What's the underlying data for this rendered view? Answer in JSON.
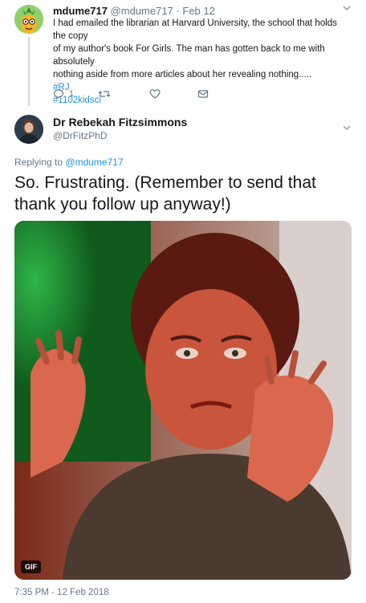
{
  "parent_tweet": {
    "display_name": "mdume717",
    "handle": "@mdume717",
    "separator": "·",
    "date": "Feb 12",
    "text_lines": [
      "I had emailed the librarian at Harvard University, the school that holds the copy",
      "of my author's book For Girls. The man has gotten back to me with absolutely",
      "nothing aside from more articles about her revealing nothing....."
    ],
    "hashtags": [
      "#RJ",
      "#1102kidsci"
    ],
    "reply_count": "1",
    "avatar_icon": "pineapple-avatar-icon"
  },
  "main_tweet": {
    "display_name": "Dr Rebekah Fitzsimmons",
    "handle": "@DrFitzPhD",
    "replying_to_prefix": "Replying to",
    "replying_to_handle": "@mdume717",
    "text": "So. Frustrating. (Remember to send that thank you follow up anyway!)",
    "media_badge": "GIF",
    "timestamp": "7:35 PM - 12 Feb 2018"
  },
  "colors": {
    "link": "#1b95e0",
    "muted": "#657786",
    "thread_line": "#ccd6dd"
  }
}
